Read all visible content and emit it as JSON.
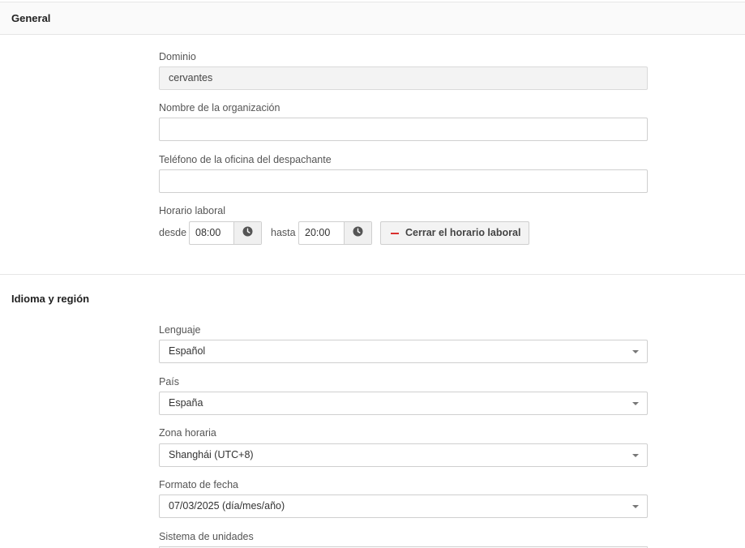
{
  "sections": {
    "general": {
      "title": "General"
    },
    "region": {
      "title": "Idioma y región"
    }
  },
  "general": {
    "domain": {
      "label": "Dominio",
      "value": "cervantes"
    },
    "organization": {
      "label": "Nombre de la organización",
      "value": ""
    },
    "phone": {
      "label": "Teléfono de la oficina del despachante",
      "value": ""
    },
    "hours": {
      "label": "Horario laboral",
      "from_label": "desde",
      "from_value": "08:00",
      "to_label": "hasta",
      "to_value": "20:00",
      "close_button": "Cerrar el horario laboral"
    }
  },
  "region": {
    "language": {
      "label": "Lenguaje",
      "value": "Español"
    },
    "country": {
      "label": "País",
      "value": "España"
    },
    "timezone": {
      "label": "Zona horaria",
      "value": "Shanghái (UTC+8)"
    },
    "date_format": {
      "label": "Formato de fecha",
      "value": "07/03/2025 (día/mes/año)"
    },
    "units": {
      "label": "Sistema de unidades"
    }
  },
  "colors": {
    "accent_minus": "#d9302f",
    "disabled_bg": "#f3f3f3"
  },
  "icons": [
    "clock-icon",
    "minus-icon",
    "caret-down-icon"
  ]
}
